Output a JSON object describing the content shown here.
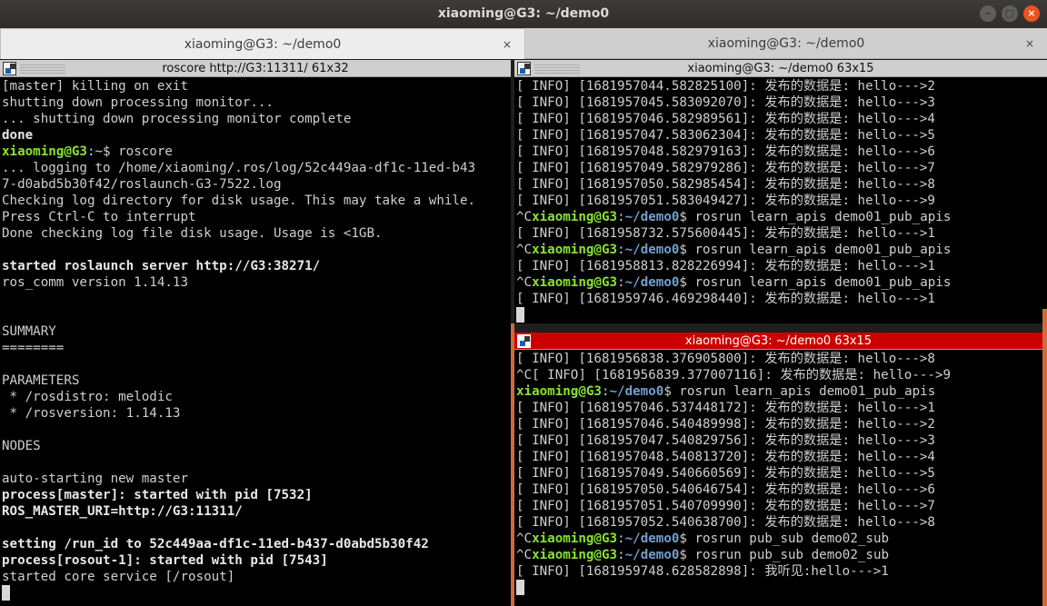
{
  "window": {
    "title": "xiaoming@G3: ~/demo0",
    "btn_min": "–",
    "btn_max": "□",
    "btn_close": "×"
  },
  "tabs": [
    {
      "label": "xiaoming@G3: ~/demo0",
      "close": "×"
    },
    {
      "label": "xiaoming@G3: ~/demo0",
      "close": "×"
    }
  ],
  "panes": {
    "left": {
      "title": "roscore http://G3:11311/ 61x32",
      "lines": [
        {
          "segs": [
            {
              "t": "[master] killing on exit"
            }
          ]
        },
        {
          "segs": [
            {
              "t": "shutting down processing monitor..."
            }
          ]
        },
        {
          "segs": [
            {
              "t": "... shutting down processing monitor complete"
            }
          ]
        },
        {
          "segs": [
            {
              "t": "done",
              "c": "bold"
            }
          ]
        },
        {
          "segs": [
            {
              "t": "xiaoming@G3",
              "c": "prompt-user"
            },
            {
              "t": ":~$ roscore"
            }
          ]
        },
        {
          "segs": [
            {
              "t": "... logging to /home/xiaoming/.ros/log/52c449aa-df1c-11ed-b43"
            }
          ]
        },
        {
          "segs": [
            {
              "t": "7-d0abd5b30f42/roslaunch-G3-7522.log"
            }
          ]
        },
        {
          "segs": [
            {
              "t": "Checking log directory for disk usage. This may take a while."
            }
          ]
        },
        {
          "segs": [
            {
              "t": "Press Ctrl-C to interrupt"
            }
          ]
        },
        {
          "segs": [
            {
              "t": "Done checking log file disk usage. Usage is <1GB."
            }
          ]
        },
        {
          "segs": [
            {
              "t": ""
            }
          ]
        },
        {
          "segs": [
            {
              "t": "started roslaunch server http://G3:38271/",
              "c": "bold"
            }
          ]
        },
        {
          "segs": [
            {
              "t": "ros_comm version 1.14.13"
            }
          ]
        },
        {
          "segs": [
            {
              "t": ""
            }
          ]
        },
        {
          "segs": [
            {
              "t": ""
            }
          ]
        },
        {
          "segs": [
            {
              "t": "SUMMARY"
            }
          ]
        },
        {
          "segs": [
            {
              "t": "========"
            }
          ]
        },
        {
          "segs": [
            {
              "t": ""
            }
          ]
        },
        {
          "segs": [
            {
              "t": "PARAMETERS"
            }
          ]
        },
        {
          "segs": [
            {
              "t": " * /rosdistro: melodic"
            }
          ]
        },
        {
          "segs": [
            {
              "t": " * /rosversion: 1.14.13"
            }
          ]
        },
        {
          "segs": [
            {
              "t": ""
            }
          ]
        },
        {
          "segs": [
            {
              "t": "NODES"
            }
          ]
        },
        {
          "segs": [
            {
              "t": ""
            }
          ]
        },
        {
          "segs": [
            {
              "t": "auto-starting new master"
            }
          ]
        },
        {
          "segs": [
            {
              "t": "process[master]: started with pid [7532]",
              "c": "bold"
            }
          ]
        },
        {
          "segs": [
            {
              "t": "ROS_MASTER_URI=http://G3:11311/",
              "c": "bold"
            }
          ]
        },
        {
          "segs": [
            {
              "t": ""
            }
          ]
        },
        {
          "segs": [
            {
              "t": "setting /run_id to 52c449aa-df1c-11ed-b437-d0abd5b30f42",
              "c": "bold"
            }
          ]
        },
        {
          "segs": [
            {
              "t": "process[rosout-1]: started with pid [7543]",
              "c": "bold"
            }
          ]
        },
        {
          "segs": [
            {
              "t": "started core service [/rosout]"
            }
          ]
        }
      ]
    },
    "top_right": {
      "title": "xiaoming@G3: ~/demo0 63x15",
      "lines": [
        {
          "segs": [
            {
              "t": "[ INFO] [1681957044.582825100]: 发布的数据是: hello--->2"
            }
          ]
        },
        {
          "segs": [
            {
              "t": "[ INFO] [1681957045.583092070]: 发布的数据是: hello--->3"
            }
          ]
        },
        {
          "segs": [
            {
              "t": "[ INFO] [1681957046.582989561]: 发布的数据是: hello--->4"
            }
          ]
        },
        {
          "segs": [
            {
              "t": "[ INFO] [1681957047.583062304]: 发布的数据是: hello--->5"
            }
          ]
        },
        {
          "segs": [
            {
              "t": "[ INFO] [1681957048.582979163]: 发布的数据是: hello--->6"
            }
          ]
        },
        {
          "segs": [
            {
              "t": "[ INFO] [1681957049.582979286]: 发布的数据是: hello--->7"
            }
          ]
        },
        {
          "segs": [
            {
              "t": "[ INFO] [1681957050.582985454]: 发布的数据是: hello--->8"
            }
          ]
        },
        {
          "segs": [
            {
              "t": "[ INFO] [1681957051.583049427]: 发布的数据是: hello--->9"
            }
          ]
        },
        {
          "segs": [
            {
              "t": "^C"
            },
            {
              "t": "xiaoming@G3",
              "c": "prompt-user"
            },
            {
              "t": ":"
            },
            {
              "t": "~/demo0",
              "c": "prompt-path"
            },
            {
              "t": "$ rosrun learn_apis demo01_pub_apis"
            }
          ]
        },
        {
          "segs": [
            {
              "t": "[ INFO] [1681958732.575600445]: 发布的数据是: hello--->1"
            }
          ]
        },
        {
          "segs": [
            {
              "t": "^C"
            },
            {
              "t": "xiaoming@G3",
              "c": "prompt-user"
            },
            {
              "t": ":"
            },
            {
              "t": "~/demo0",
              "c": "prompt-path"
            },
            {
              "t": "$ rosrun learn_apis demo01_pub_apis"
            }
          ]
        },
        {
          "segs": [
            {
              "t": "[ INFO] [1681958813.828226994]: 发布的数据是: hello--->1"
            }
          ]
        },
        {
          "segs": [
            {
              "t": "^C"
            },
            {
              "t": "xiaoming@G3",
              "c": "prompt-user"
            },
            {
              "t": ":"
            },
            {
              "t": "~/demo0",
              "c": "prompt-path"
            },
            {
              "t": "$ rosrun learn_apis demo01_pub_apis"
            }
          ]
        },
        {
          "segs": [
            {
              "t": "[ INFO] [1681959746.469298440]: 发布的数据是: hello--->1"
            }
          ]
        }
      ]
    },
    "bottom_right": {
      "title": "xiaoming@G3: ~/demo0 63x15",
      "lines": [
        {
          "segs": [
            {
              "t": "[ INFO] [1681956838.376905800]: 发布的数据是: hello--->8"
            }
          ]
        },
        {
          "segs": [
            {
              "t": "^C[ INFO] [1681956839.377007116]: 发布的数据是: hello--->9"
            }
          ]
        },
        {
          "segs": [
            {
              "t": "xiaoming@G3",
              "c": "prompt-user"
            },
            {
              "t": ":"
            },
            {
              "t": "~/demo0",
              "c": "prompt-path"
            },
            {
              "t": "$ rosrun learn_apis demo01_pub_apis"
            }
          ]
        },
        {
          "segs": [
            {
              "t": "[ INFO] [1681957046.537448172]: 发布的数据是: hello--->1"
            }
          ]
        },
        {
          "segs": [
            {
              "t": "[ INFO] [1681957046.540489998]: 发布的数据是: hello--->2"
            }
          ]
        },
        {
          "segs": [
            {
              "t": "[ INFO] [1681957047.540829756]: 发布的数据是: hello--->3"
            }
          ]
        },
        {
          "segs": [
            {
              "t": "[ INFO] [1681957048.540813720]: 发布的数据是: hello--->4"
            }
          ]
        },
        {
          "segs": [
            {
              "t": "[ INFO] [1681957049.540660569]: 发布的数据是: hello--->5"
            }
          ]
        },
        {
          "segs": [
            {
              "t": "[ INFO] [1681957050.540646754]: 发布的数据是: hello--->6"
            }
          ]
        },
        {
          "segs": [
            {
              "t": "[ INFO] [1681957051.540709990]: 发布的数据是: hello--->7"
            }
          ]
        },
        {
          "segs": [
            {
              "t": "[ INFO] [1681957052.540638700]: 发布的数据是: hello--->8"
            }
          ]
        },
        {
          "segs": [
            {
              "t": "^C"
            },
            {
              "t": "xiaoming@G3",
              "c": "prompt-user"
            },
            {
              "t": ":"
            },
            {
              "t": "~/demo0",
              "c": "prompt-path"
            },
            {
              "t": "$ rosrun pub_sub demo02_sub"
            }
          ]
        },
        {
          "segs": [
            {
              "t": "^C"
            },
            {
              "t": "xiaoming@G3",
              "c": "prompt-user"
            },
            {
              "t": ":"
            },
            {
              "t": "~/demo0",
              "c": "prompt-path"
            },
            {
              "t": "$ rosrun pub_sub demo02_sub"
            }
          ]
        },
        {
          "segs": [
            {
              "t": "[ INFO] [1681959748.628582898]: 我听见:hello--->1"
            }
          ]
        }
      ]
    }
  }
}
